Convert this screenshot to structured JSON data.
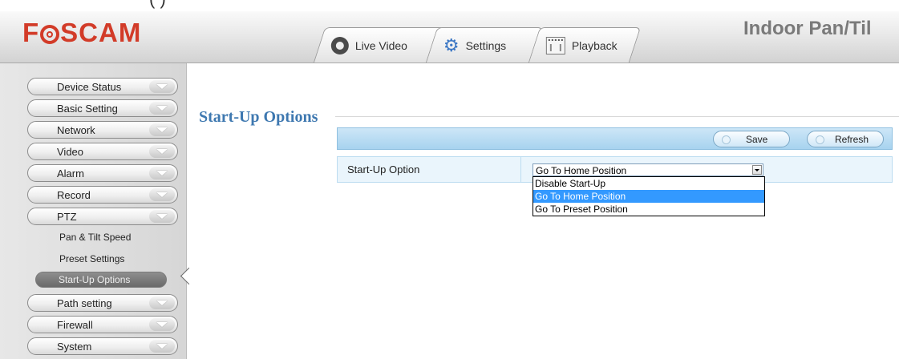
{
  "caption": {
    "text": "(         )"
  },
  "header": {
    "logo": {
      "left": "F",
      "right": "SCAM"
    },
    "brand_title": "Indoor Pan/Til",
    "tabs": [
      {
        "label": "Live Video",
        "icon": "webcam-icon"
      },
      {
        "label": "Settings",
        "icon": "gears-icon"
      },
      {
        "label": "Playback",
        "icon": "calendar-icon"
      }
    ]
  },
  "sidebar": {
    "items": [
      {
        "label": "Device Status"
      },
      {
        "label": "Basic Setting"
      },
      {
        "label": "Network"
      },
      {
        "label": "Video"
      },
      {
        "label": "Alarm"
      },
      {
        "label": "Record"
      },
      {
        "label": "PTZ"
      }
    ],
    "ptz_subitems": [
      {
        "label": "Pan & Tilt Speed"
      },
      {
        "label": "Preset Settings"
      }
    ],
    "active_subitem": "Start-Up Options",
    "items_after": [
      {
        "label": "Path setting"
      },
      {
        "label": "Firewall"
      },
      {
        "label": "System"
      }
    ]
  },
  "main": {
    "section_title": "Start-Up Options",
    "toolbar": {
      "save_label": "Save",
      "refresh_label": "Refresh"
    },
    "form": {
      "startup_label": "Start-Up Option",
      "startup_value": "Go To Home Position",
      "options": [
        "Disable Start-Up",
        "Go To Home Position",
        "Go To Preset Position"
      ],
      "selected_index": 1
    }
  },
  "colors": {
    "brand_red": "#d23b28",
    "title_blue": "#3e78b0",
    "toolbar_blue": "#a7d3ef",
    "selection_blue": "#3399ff"
  }
}
